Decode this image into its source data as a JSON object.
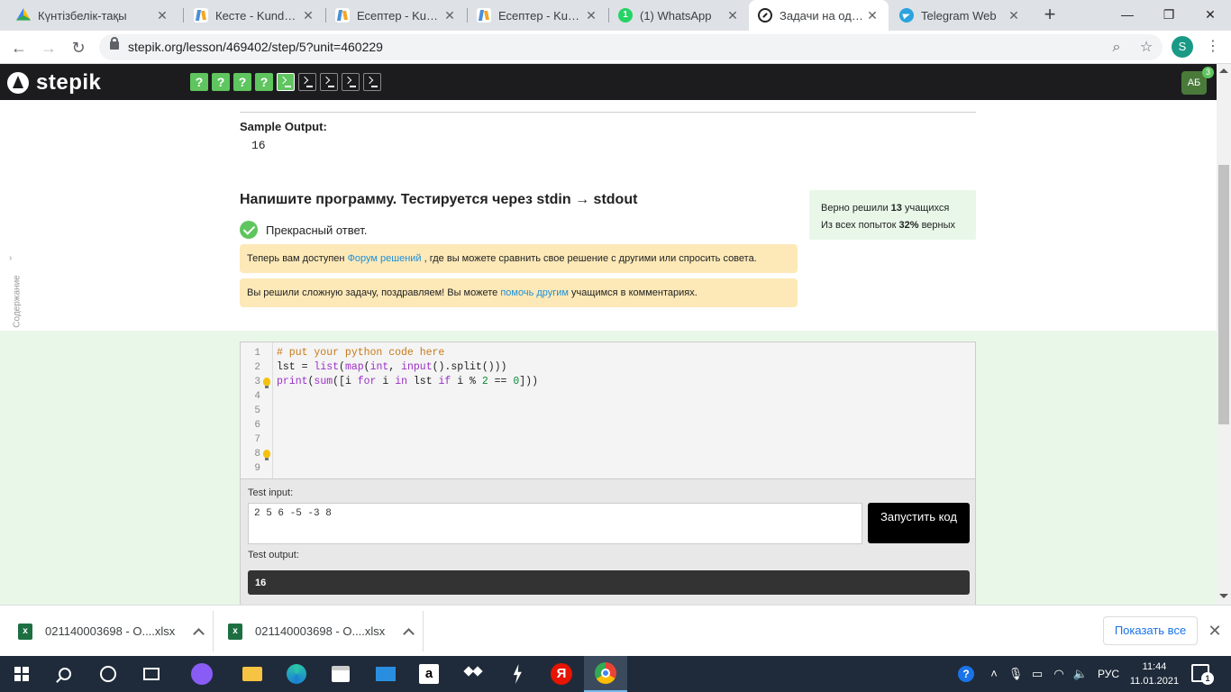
{
  "browser": {
    "tabs": [
      {
        "title": "Күнтізбелік-тақы",
        "icon": "google-drive-icon"
      },
      {
        "title": "Кесте - Kundelik.kz",
        "icon": "kundelik-icon"
      },
      {
        "title": "Есептер - Kundelik.kz",
        "icon": "kundelik-icon"
      },
      {
        "title": "Есептер - Kundelik.kz",
        "icon": "kundelik-icon"
      },
      {
        "title": "(1) WhatsApp",
        "icon": "whatsapp-icon",
        "badge": "1"
      },
      {
        "title": "Задачи на одном",
        "icon": "stepik-icon",
        "active": true
      },
      {
        "title": "Telegram Web",
        "icon": "telegram-icon"
      }
    ],
    "url": "stepik.org/lesson/469402/step/5?unit=460229",
    "profile_initial": "S"
  },
  "stepik": {
    "logo": "stepik",
    "steps": [
      {
        "type": "quiz",
        "label": "?",
        "done": true
      },
      {
        "type": "quiz",
        "label": "?",
        "done": true
      },
      {
        "type": "quiz",
        "label": "?",
        "done": true
      },
      {
        "type": "quiz",
        "label": "?",
        "done": true
      },
      {
        "type": "code",
        "done": true,
        "current": true
      },
      {
        "type": "code",
        "done": false
      },
      {
        "type": "code",
        "done": false
      },
      {
        "type": "code",
        "done": false
      },
      {
        "type": "code",
        "done": false
      }
    ],
    "user_initials": "АБ",
    "user_count": "3"
  },
  "sidebar": {
    "label": "Содержание"
  },
  "step": {
    "sample_output_title": "Sample Output:",
    "sample_output_value": "16",
    "task_title": "Напишите программу. Тестируется через stdin → stdout",
    "correct_text": "Прекрасный ответ.",
    "notice1": {
      "before": "Теперь вам доступен ",
      "link": "Форум решений",
      "after": " , где вы можете сравнить свое решение с другими или спросить совета."
    },
    "notice2": {
      "before": "Вы решили сложную задачу, поздравляем! Вы можете ",
      "link": "помочь другим",
      "after": " учащимся в комментариях."
    },
    "stats": {
      "line1_before": "Верно решили ",
      "line1_value": "13",
      "line1_after": " учащихся",
      "line2_before": "Из всех попыток ",
      "line2_value": "32%",
      "line2_after": " верных"
    }
  },
  "editor": {
    "line_numbers": [
      "1",
      "2",
      "3",
      "4",
      "5",
      "6",
      "7",
      "8",
      "9"
    ],
    "lines": [
      "# put your python code here",
      "lst = list(map(int, input().split()))",
      "print(sum([i for i in lst if i % 2 == 0]))",
      "",
      "",
      "",
      "",
      "",
      ""
    ]
  },
  "test": {
    "input_label": "Test input:",
    "input_value": "2 5 6 -5 -3 8",
    "run_button": "Запустить код",
    "output_label": "Test output:",
    "output_value": "16"
  },
  "downloads": {
    "items": [
      {
        "name": "021140003698 - О....xlsx"
      },
      {
        "name": "021140003698 - О....xlsx"
      }
    ],
    "show_all": "Показать все"
  },
  "taskbar": {
    "language": "РУС",
    "time": "11:44",
    "date": "11.01.2021",
    "notification_count": "1"
  }
}
